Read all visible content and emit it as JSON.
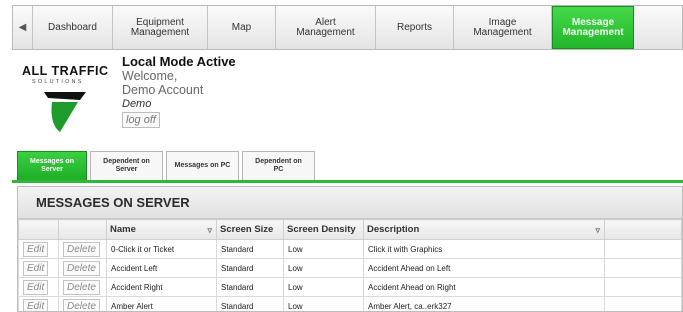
{
  "nav": {
    "tabs": [
      {
        "label": "Dashboard",
        "active": false
      },
      {
        "label": "Equipment\nManagement",
        "active": false
      },
      {
        "label": "Map",
        "active": false
      },
      {
        "label": "Alert\nManagement",
        "active": false
      },
      {
        "label": "Reports",
        "active": false
      },
      {
        "label": "Image\nManagement",
        "active": false
      },
      {
        "label": "Message\nManagement",
        "active": true
      }
    ]
  },
  "brand": {
    "title": "ALL TRAFFIC",
    "subtitle": "SOLUTIONS"
  },
  "account": {
    "mode": "Local Mode Active",
    "welcome": "Welcome,",
    "account_name": "Demo Account",
    "user": "Demo",
    "logoff_label": "log off"
  },
  "subtabs": [
    {
      "label": "Messages on\nServer",
      "active": true
    },
    {
      "label": "Dependent on\nServer",
      "active": false
    },
    {
      "label": "Messages on PC",
      "active": false
    },
    {
      "label": "Dependent on\nPC",
      "active": false
    }
  ],
  "panel": {
    "title": "MESSAGES ON SERVER",
    "columns": [
      "",
      "",
      "Name",
      "Screen Size",
      "Screen Density",
      "Description"
    ],
    "edit_label": "Edit",
    "delete_label": "Delete",
    "rows": [
      {
        "name": "0-Click it or Ticket",
        "size": "Standard",
        "density": "Low",
        "description": "Click it with Graphics"
      },
      {
        "name": "Accident Left",
        "size": "Standard",
        "density": "Low",
        "description": "Accident Ahead on Left"
      },
      {
        "name": "Accident Right",
        "size": "Standard",
        "density": "Low",
        "description": "Accident Ahead on Right"
      },
      {
        "name": "Amber Alert",
        "size": "Standard",
        "density": "Low",
        "description": "Amber Alert, ca..erk327"
      }
    ]
  },
  "colors": {
    "accent_green": "#2db935",
    "logo_green": "#1f9a2c"
  }
}
